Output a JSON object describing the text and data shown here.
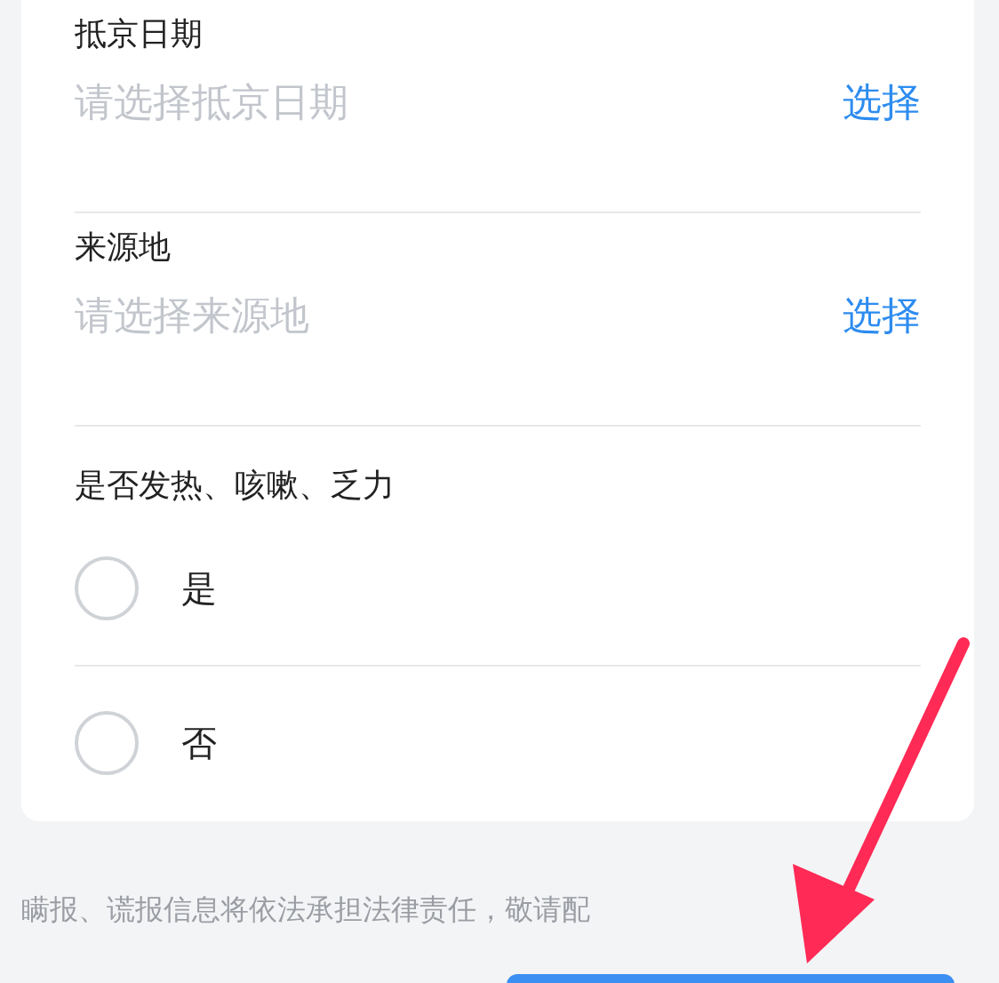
{
  "fields": [
    {
      "label": "抵京日期",
      "placeholder": "请选择抵京日期",
      "action": "选择"
    },
    {
      "label": "来源地",
      "placeholder": "请选择来源地",
      "action": "选择"
    }
  ],
  "question": {
    "label": "是否发热、咳嗽、乏力",
    "options": [
      {
        "label": "是",
        "selected": false
      },
      {
        "label": "否",
        "selected": false
      }
    ]
  },
  "notice": "瞒报、谎报信息将依法承担法律责任，敬请配"
}
